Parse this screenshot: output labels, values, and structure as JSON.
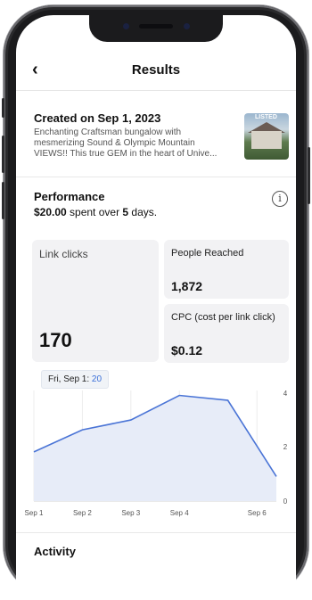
{
  "header": {
    "back_icon": "chevron-left-icon",
    "title": "Results"
  },
  "ad": {
    "created": "Created on Sep 1, 2023",
    "description_lines": [
      "Enchanting Craftsman bungalow with",
      "mesmerizing Sound & Olympic Mountain",
      "VIEWS!! This true GEM in the heart of Unive..."
    ],
    "thumb_badge": "LISTED"
  },
  "performance": {
    "title": "Performance",
    "spent": "$20.00",
    "spent_mid": " spent over ",
    "days": "5",
    "days_suffix": " days.",
    "info_glyph": "i"
  },
  "metrics": {
    "link_clicks": {
      "label": "Link clicks",
      "value": "170"
    },
    "people_reached": {
      "label": "People Reached",
      "value": "1,872"
    },
    "cpc": {
      "label": "CPC (cost per link click)",
      "value": "$0.12"
    }
  },
  "tooltip": {
    "date": "Fri, Sep 1: ",
    "value": "20"
  },
  "chart_data": {
    "type": "area",
    "x": [
      "Sep 1",
      "Sep 2",
      "Sep 3",
      "Sep 4",
      "Sep 6"
    ],
    "series": [
      {
        "values": [
          20,
          29,
          33,
          43,
          41,
          10
        ]
      }
    ],
    "x_positions_days": [
      0,
      1,
      2,
      3,
      4,
      5
    ],
    "tick_labels_x": [
      "Sep 1",
      "Sep 2",
      "Sep 3",
      "Sep 4",
      "Sep 6"
    ],
    "tick_days": [
      0,
      1,
      2,
      3,
      4.6
    ],
    "y_ticks": [
      "4",
      "2",
      "0"
    ],
    "ylim": [
      0,
      45
    ],
    "line_color": "#4a74d6",
    "fill_color": "#e7ecf8",
    "grid": true
  },
  "activity": {
    "title": "Activity"
  }
}
